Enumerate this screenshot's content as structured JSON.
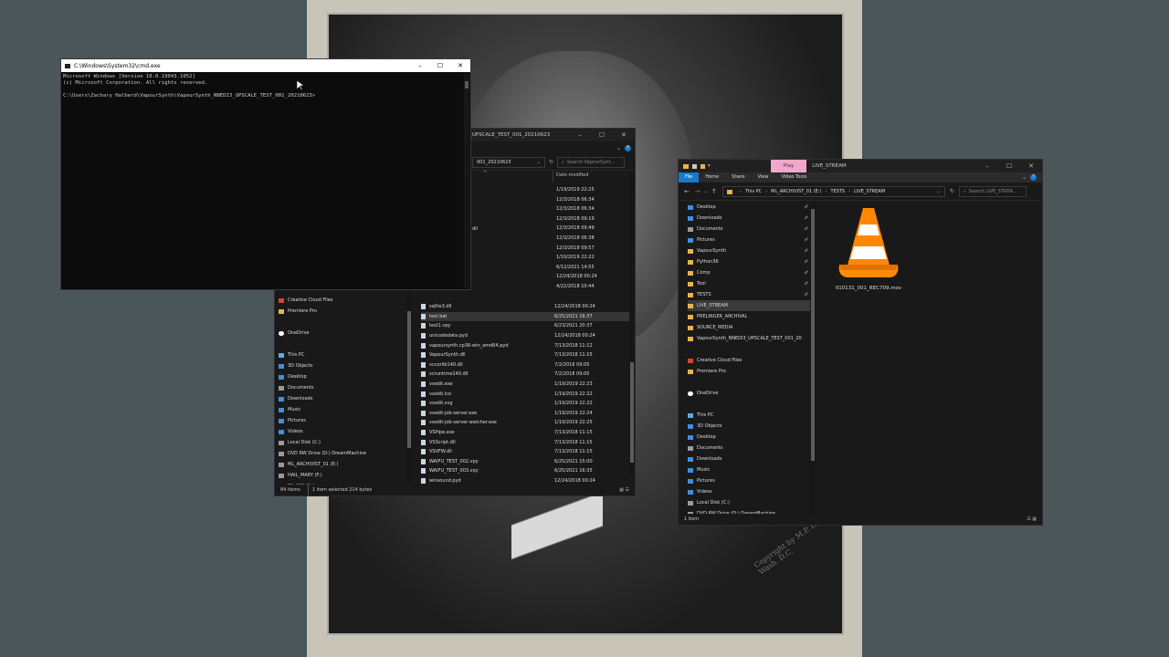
{
  "cmd": {
    "title": "C:\\Windows\\System32\\cmd.exe",
    "lines": [
      "Microsoft Windows [Version 10.0.19043.1052]",
      "(c) Microsoft Corporation. All rights reserved.",
      "",
      "C:\\Users\\Zachary Halberd\\VapourSynth\\VapourSynth_NNEDI3_UPSCALE_TEST_001_20210623>"
    ]
  },
  "mid_explorer": {
    "title": "I3_UPSCALE_TEST_001_20210623",
    "address": "001_20210623",
    "search_placeholder": "Search VapourSynt...",
    "date_header": "Date modified",
    "top_dates": [
      "1/19/2019 22:25",
      "12/3/2018 06:34",
      "12/3/2018 06:34",
      "12/3/2018 09:19",
      "12/3/2018 09:49",
      "12/3/2018 06:38",
      "12/3/2018 09:57",
      "1/19/2019 22:22",
      "6/12/2021 14:55",
      "12/24/2018 00:24",
      "4/22/2018 10:44"
    ],
    "partial_dll": "dll",
    "nav": [
      {
        "label": "Creative Cloud Files",
        "icon": "cc"
      },
      {
        "label": "Premiere Pro",
        "icon": "folder"
      },
      {
        "label": "",
        "icon": ""
      },
      {
        "label": "OneDrive",
        "icon": "cloud"
      },
      {
        "label": "",
        "icon": ""
      },
      {
        "label": "This PC",
        "icon": "pc"
      },
      {
        "label": "3D Objects",
        "icon": "blue"
      },
      {
        "label": "Desktop",
        "icon": "blue"
      },
      {
        "label": "Documents",
        "icon": "drive"
      },
      {
        "label": "Downloads",
        "icon": "blue"
      },
      {
        "label": "Music",
        "icon": "blue"
      },
      {
        "label": "Pictures",
        "icon": "blue"
      },
      {
        "label": "Videos",
        "icon": "blue"
      },
      {
        "label": "Local Disk (C:)",
        "icon": "drive"
      },
      {
        "label": "DVD RW Drive (D:) DreamMachine",
        "icon": "drive"
      },
      {
        "label": "ML_ARCHIVIST_01 (E:)",
        "icon": "drive"
      },
      {
        "label": "HAIL_MARY (F:)",
        "icon": "drive"
      },
      {
        "label": "ML_NIX (H:)",
        "icon": "drive"
      }
    ],
    "files": [
      {
        "name": "sqlite3.dll",
        "date": "12/24/2018 00:24"
      },
      {
        "name": "test.bat",
        "date": "6/25/2021 16:37",
        "selected": true
      },
      {
        "name": "test1.vpy",
        "date": "6/23/2021 20:37"
      },
      {
        "name": "unicodedata.pyd",
        "date": "12/24/2018 00:24"
      },
      {
        "name": "vapoursynth.cp36-win_amd64.pyd",
        "date": "7/13/2018 11:12"
      },
      {
        "name": "VapourSynth.dll",
        "date": "7/13/2018 11:15"
      },
      {
        "name": "vccorlib140.dll",
        "date": "7/2/2018 09:05"
      },
      {
        "name": "vcruntime140.dll",
        "date": "7/2/2018 09:05"
      },
      {
        "name": "vsedit.exe",
        "date": "1/19/2019 22:23"
      },
      {
        "name": "vsedit.ico",
        "date": "1/19/2019 22:22"
      },
      {
        "name": "vsedit.svg",
        "date": "1/19/2019 22:22"
      },
      {
        "name": "vsedit-job-server.exe",
        "date": "1/19/2019 22:24"
      },
      {
        "name": "vsedit-job-server-watcher.exe",
        "date": "1/19/2019 22:25"
      },
      {
        "name": "VSPipe.exe",
        "date": "7/13/2018 11:15"
      },
      {
        "name": "VSScript.dll",
        "date": "7/13/2018 11:15"
      },
      {
        "name": "VSVFW.dll",
        "date": "7/13/2018 11:15"
      },
      {
        "name": "WAIFU_TEST_002.vpy",
        "date": "6/25/2021 15:00"
      },
      {
        "name": "WAIFU_TEST_003.vpy",
        "date": "6/25/2021 16:35"
      },
      {
        "name": "winsound.pyd",
        "date": "12/24/2018 00:24"
      }
    ],
    "status_items": "84 items",
    "status_selected": "1 item selected  214 bytes"
  },
  "right_explorer": {
    "play_tab": "Play",
    "title": "LIVE_STREAM",
    "ribbon_tabs": [
      "File",
      "Home",
      "Share",
      "View",
      "Video Tools"
    ],
    "breadcrumb": [
      "This PC",
      "ML_ARCHIVIST_01 (E:)",
      "TESTS",
      "LIVE_STREAM"
    ],
    "search_placeholder": "Search LIVE_STREA...",
    "nav": [
      {
        "label": "Desktop",
        "icon": "blue",
        "pin": true
      },
      {
        "label": "Downloads",
        "icon": "blue",
        "pin": true
      },
      {
        "label": "Documents",
        "icon": "drive",
        "pin": true
      },
      {
        "label": "Pictures",
        "icon": "blue",
        "pin": true
      },
      {
        "label": "VapourSynth",
        "icon": "folder",
        "pin": true
      },
      {
        "label": "Python36",
        "icon": "folder",
        "pin": true
      },
      {
        "label": "Comp",
        "icon": "folder",
        "pin": true
      },
      {
        "label": "Tool",
        "icon": "folder",
        "pin": true
      },
      {
        "label": "TESTS",
        "icon": "folder",
        "pin": true
      },
      {
        "label": "LIVE_STREAM",
        "icon": "folder",
        "selected": true
      },
      {
        "label": "PRELINGER_ARCHIVAL",
        "icon": "folder"
      },
      {
        "label": "SOURCE_MEDIA",
        "icon": "folder"
      },
      {
        "label": "VapourSynth_NNEDI3_UPSCALE_TEST_001_20",
        "icon": "folder"
      },
      {
        "label": "",
        "icon": ""
      },
      {
        "label": "Creative Cloud Files",
        "icon": "cc"
      },
      {
        "label": "Premiere Pro",
        "icon": "folder"
      },
      {
        "label": "",
        "icon": ""
      },
      {
        "label": "OneDrive",
        "icon": "cloud"
      },
      {
        "label": "",
        "icon": ""
      },
      {
        "label": "This PC",
        "icon": "pc"
      },
      {
        "label": "3D Objects",
        "icon": "blue"
      },
      {
        "label": "Desktop",
        "icon": "blue"
      },
      {
        "label": "Documents",
        "icon": "drive"
      },
      {
        "label": "Downloads",
        "icon": "blue"
      },
      {
        "label": "Music",
        "icon": "blue"
      },
      {
        "label": "Pictures",
        "icon": "blue"
      },
      {
        "label": "Videos",
        "icon": "blue"
      },
      {
        "label": "Local Disk (C:)",
        "icon": "drive"
      },
      {
        "label": "DVD RW Drive (D:) DreamMachine",
        "icon": "drive"
      },
      {
        "label": "ML_ARCHIVIST_01 (E:)",
        "icon": "drive"
      },
      {
        "label": "HAIL_MARY (F:)",
        "icon": "drive"
      }
    ],
    "file_name": "010131_001_REC709.mov",
    "status_items": "1 item"
  },
  "photo_signature": "Copyright\nby M.P. Rice\nWash. D.C."
}
